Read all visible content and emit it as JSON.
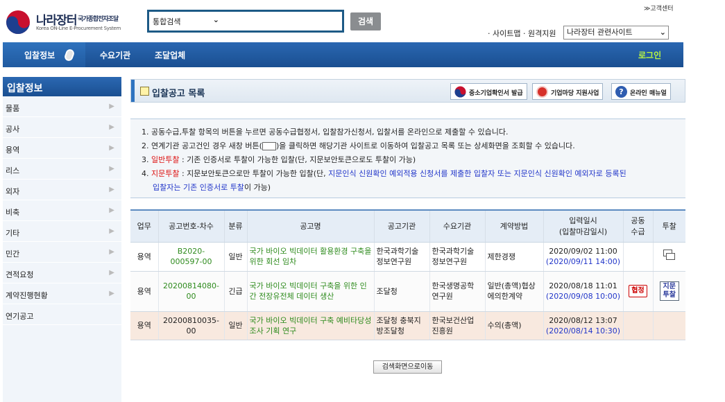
{
  "header": {
    "logo_name": "나라장터",
    "logo_sub": "국가종합전자조달",
    "logo_en": "Korea ON-Line E-Procurement System",
    "search_scope": "통합검색",
    "search_value": "",
    "search_button": "검색",
    "customer_center": "≫고객센터",
    "util_links": "· 사이트맵 · 원격지원",
    "related_sites": "나라장터 관련사이트"
  },
  "nav": {
    "items": [
      "입찰정보",
      "수요기관",
      "조달업체"
    ],
    "login": "로그인"
  },
  "sidebar": {
    "title": "입찰정보",
    "items": [
      "물품",
      "공사",
      "용역",
      "리스",
      "외자",
      "비축",
      "기타",
      "민간",
      "견적요청",
      "계약진행현황",
      "연기공고"
    ]
  },
  "page": {
    "title": "입찰공고 목록",
    "buttons": [
      "중소기업확인서 발급",
      "기업마당 지원사업",
      "온라인 매뉴얼"
    ]
  },
  "notice": {
    "line1": "1. 공동수급,투찰 항목의 버튼을 누르면 공동수급협정서, 입찰참가신청서, 입찰서를 온라인으로 제출할 수 있습니다.",
    "line2_a": "2. 연계기관 공고건인 경우 새창 버튼(",
    "line2_b": ")을 클릭하면 해당기관 사이트로 이동하여 입찰공고 목록 또는 상세화면을 조회할 수 있습니다.",
    "line3_prefix": "3. ",
    "line3_red": "일반투찰",
    "line3_rest": " : 기존 인증서로 투찰이 가능한 입찰(단, 지문보안토큰으로도 투찰이 가능)",
    "line4_prefix": "4. ",
    "line4_red": "지문투찰",
    "line4_rest": " : 지문보안토큰으로만 투찰이 가능한 입찰(단, ",
    "line4_blue": "지문인식 신원확인 예외적용 신청서를 제출한 입찰자 또는 지문인식 신원확인 예외자로 등록된",
    "line5_blue": "입찰자는 기존 인증서로 투찰",
    "line5_rest": "이 가능)"
  },
  "table": {
    "headers": [
      "업무",
      "공고번호-차수",
      "분류",
      "공고명",
      "공고기관",
      "수요기관",
      "계약방법",
      "입력일시",
      "(입찰마감일시)",
      "공동",
      "수급",
      "투찰"
    ],
    "rows": [
      {
        "biz": "용역",
        "no1": "B2020-",
        "no2": "000597-00",
        "type": "일반",
        "name": "국가 바이오 빅데이터 활용환경 구축을 위한 회선 임차",
        "org1": "한국과학기술",
        "org1b": "정보연구원",
        "dem1": "한국과학기술",
        "dem1b": "정보연구원",
        "method": "제한경쟁",
        "input": "2020/09/02 11:00",
        "deadline": "(2020/09/11 14:00)",
        "joint": "",
        "bid": "submit-window-icon"
      },
      {
        "biz": "용역",
        "no1": "20200814080-",
        "no2": "00",
        "type": "긴급",
        "name": "국가 바이오 빅데이터 구축을 위한 인간 전장유전체 데이터 생산",
        "org1": "조달청",
        "org1b": "",
        "dem1": "한국생명공학",
        "dem1b": "연구원",
        "method": "일반(총액)협상에의한계약",
        "input": "2020/08/18 11:01",
        "deadline": "(2020/09/08 10:00)",
        "joint": "협정",
        "bid": "지문투찰"
      },
      {
        "biz": "용역",
        "no1": "20200810035-",
        "no2": "00",
        "type": "일반",
        "name": "국가 바이오 빅데이터 구축 예비타당성조사 기획 연구",
        "org1": "조달청 충북지",
        "org1b": "방조달청",
        "dem1": "한국보건산업",
        "dem1b": "진흥원",
        "method": "수의(총액)",
        "input": "2020/08/12 13:07",
        "deadline": "(2020/08/14 10:30)",
        "joint": "",
        "bid": ""
      }
    ]
  },
  "back_button": "검색화면으로이동"
}
